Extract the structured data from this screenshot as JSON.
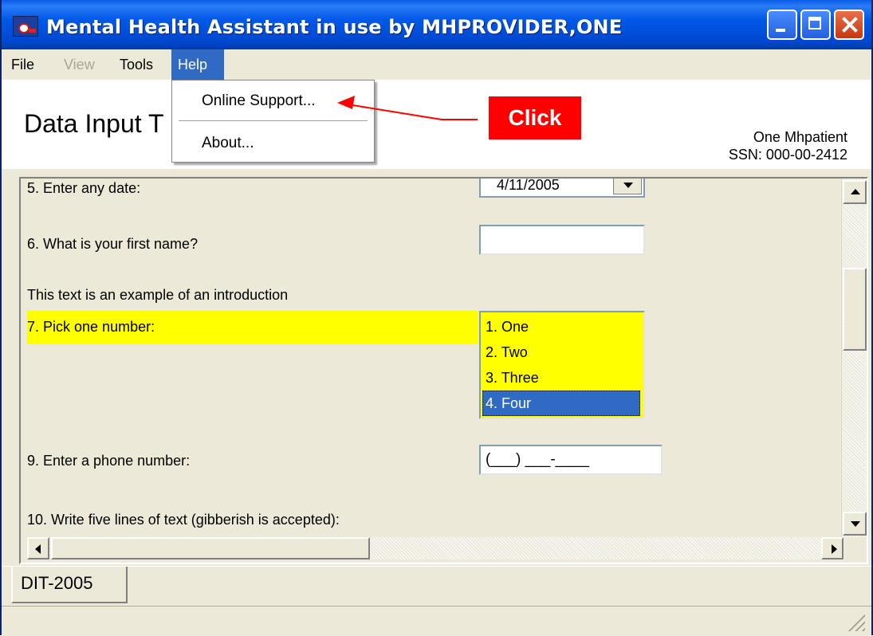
{
  "window": {
    "title": "Mental Health Assistant in use by MHPROVIDER,ONE"
  },
  "menu": {
    "file": "File",
    "view": "View",
    "tools": "Tools",
    "help": "Help"
  },
  "help_menu": {
    "items": [
      "Online Support...",
      "About..."
    ]
  },
  "header": {
    "title": "Data Input T",
    "patient_name": "One Mhpatient",
    "patient_ssn": "SSN: 000-00-2412"
  },
  "annotation": {
    "label": "Click"
  },
  "form": {
    "q5": "5. Enter any date:",
    "q5_value": "4/11/2005",
    "q6": "6. What is your first name?",
    "q6_value": "",
    "intro": "This text is an example of an introduction",
    "q7": "7. Pick one number:",
    "q7_options": [
      "1. One",
      "2. Two",
      "3. Three",
      "4. Four"
    ],
    "q7_selected": "4. Four",
    "q9": "9. Enter a phone number:",
    "q9_value": "(___) ___-____",
    "q10": "10. Write five lines of text (gibberish is accepted):"
  },
  "tabs": [
    "DIT-2005"
  ],
  "colors": {
    "titlebar": "#0054e3",
    "highlight": "#ffff00",
    "selection": "#316ac5",
    "annotation": "#ff0000"
  }
}
